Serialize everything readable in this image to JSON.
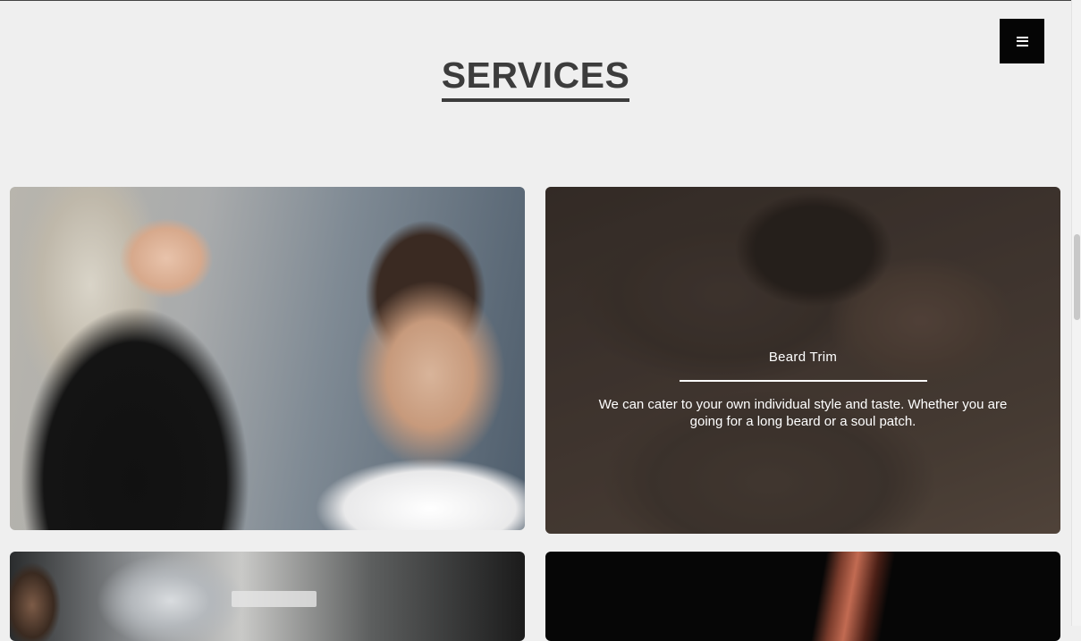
{
  "header": {
    "menu_icon": "hamburger-menu-icon"
  },
  "section": {
    "title": "SERVICES"
  },
  "cards": [
    {
      "image": "haircut-photo"
    },
    {
      "image": "beard-trim-photo",
      "title": "Beard Trim",
      "description": "We can cater to your own individual style and taste. Whether you are going for a long beard or a soul patch."
    },
    {
      "image": "hair-styling-photo"
    },
    {
      "image": "barber-photo"
    }
  ],
  "colors": {
    "background": "#efefef",
    "title": "#3c3c3c",
    "menu_button": "#050505",
    "overlay_text": "#ffffff"
  }
}
